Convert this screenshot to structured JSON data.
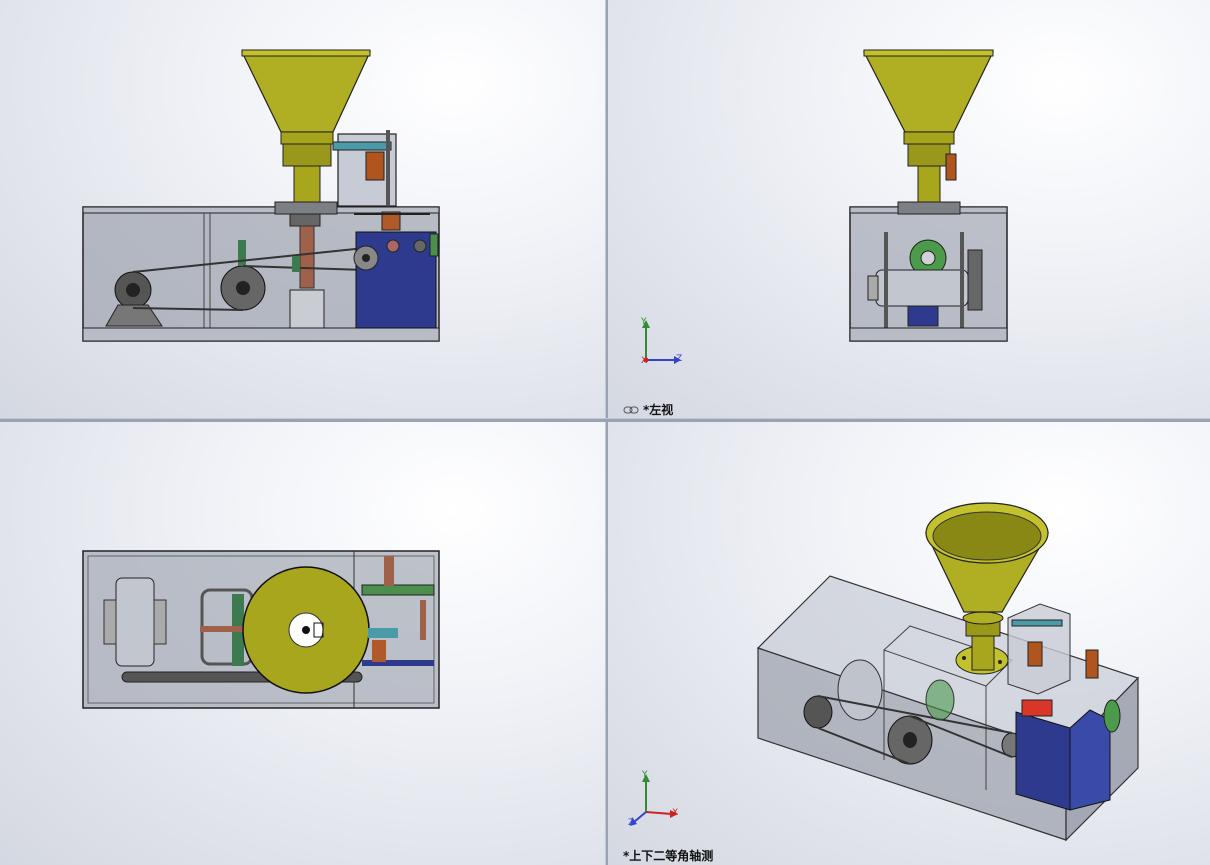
{
  "toolbar": {
    "icons": [
      "zoom-to-fit-icon",
      "zoom-to-area-icon",
      "previous-view-icon",
      "section-view-icon",
      "dynamic-annotation-icon",
      "view-orientation-icon",
      "display-style-icon",
      "hide-show-items-icon",
      "edit-appearance-icon",
      "apply-scene-icon",
      "view-settings-icon"
    ]
  },
  "viewports": {
    "top_right": {
      "label": "*左视",
      "triad": {
        "y": "Y",
        "z": "Z",
        "x": "X"
      }
    },
    "bottom_right": {
      "label": "*上下二等角轴测",
      "triad": {
        "y": "Y",
        "z": "Z",
        "x": "X"
      }
    }
  },
  "colors": {
    "hopper": "#a8a61c",
    "hopper_dark": "#6b6a0d",
    "blue_box": "#2d3a8c",
    "frame": "#9aa0ab",
    "background": "#e5e8ef"
  }
}
